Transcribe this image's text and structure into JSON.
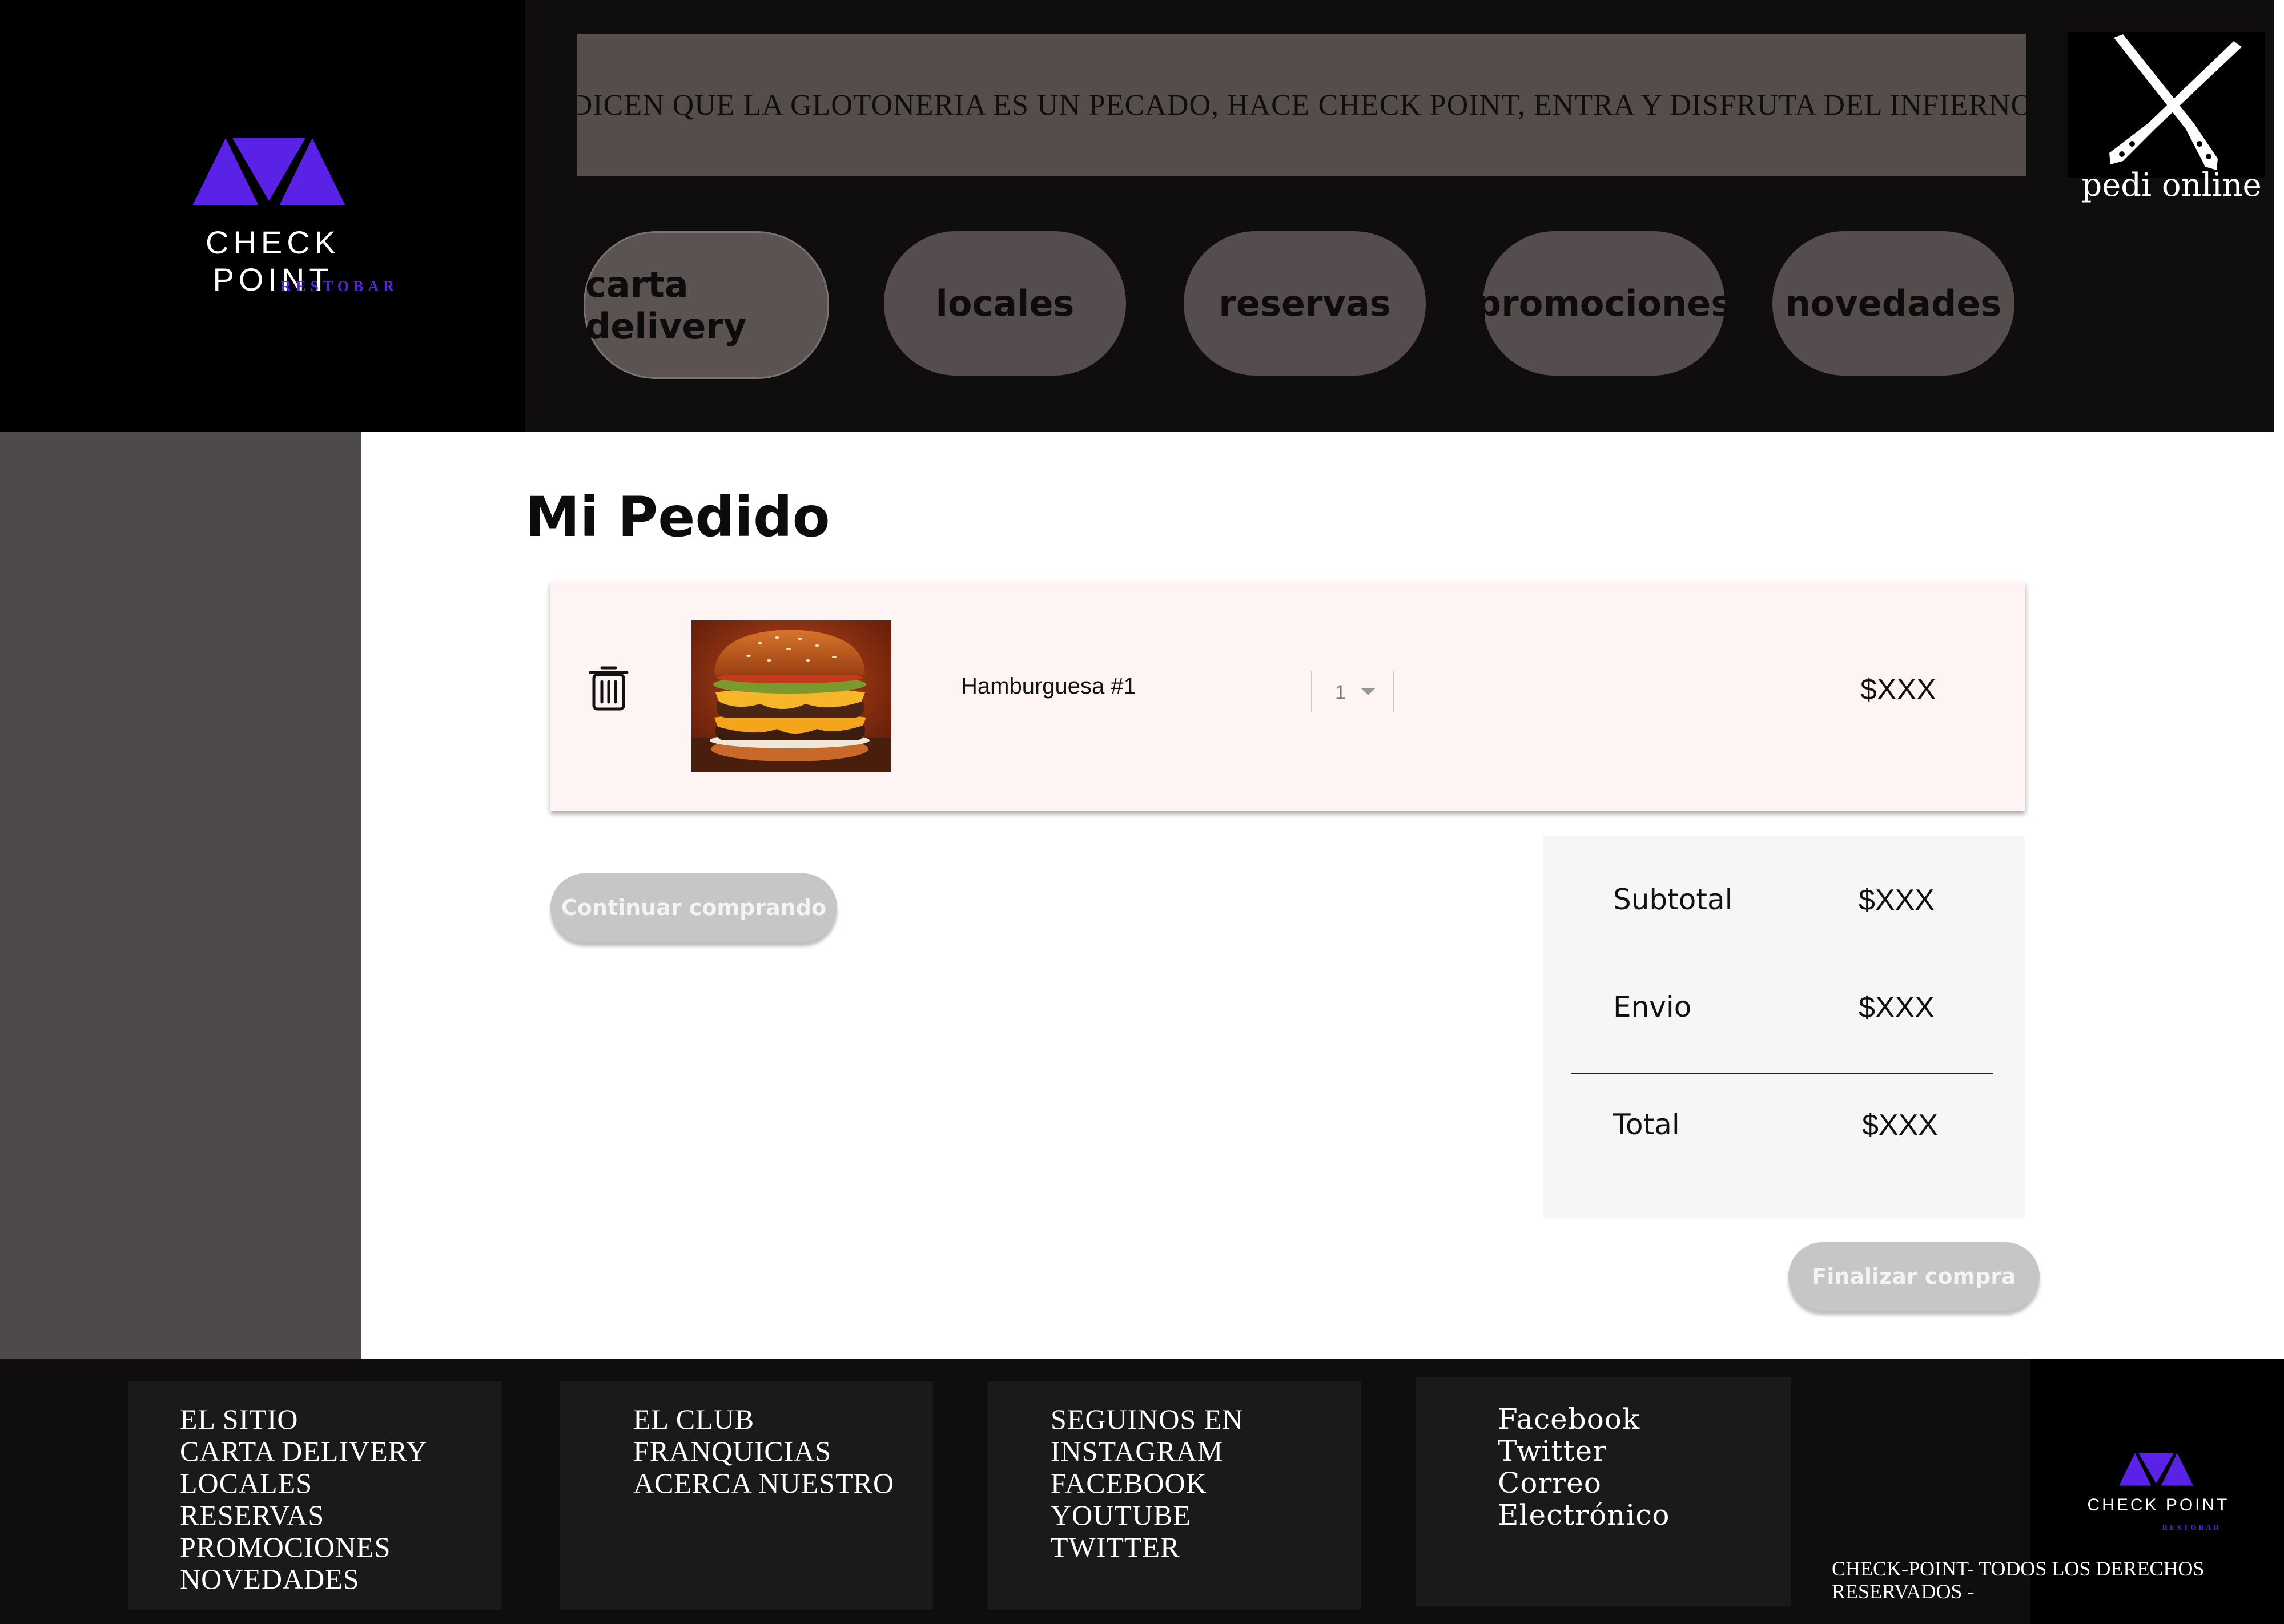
{
  "brand": {
    "name": "CHECK POINT",
    "subtitle": "RESTOBAR",
    "accent_color": "#5a22e6"
  },
  "header": {
    "slogan": "DICEN QUE LA GLOTONERIA ES UN PECADO, HACE CHECK POINT, ENTRA Y DISFRUTA DEL INFIERNO",
    "online_label": "pedi online",
    "online_icon": "crossed-knives-icon",
    "nav": [
      {
        "label": "carta delivery"
      },
      {
        "label": "locales"
      },
      {
        "label": "reservas"
      },
      {
        "label": "promociones"
      },
      {
        "label": "novedades"
      }
    ]
  },
  "main": {
    "title": "Mi Pedido",
    "cart_items": [
      {
        "name": "Hamburguesa #1",
        "quantity": "1",
        "price": "$XXX",
        "delete_icon": "trash-icon",
        "image": "burger-photo"
      }
    ],
    "continue_label": "Continuar comprando",
    "finish_label": "Finalizar compra",
    "summary": {
      "subtotal_label": "Subtotal",
      "subtotal_value": "$XXX",
      "shipping_label": "Envio",
      "shipping_value": "$XXX",
      "total_label": "Total",
      "total_value": "$XXX"
    }
  },
  "footer": {
    "columns": [
      [
        "EL SITIO",
        "CARTA DELIVERY",
        "LOCALES",
        "RESERVAS",
        "PROMOCIONES",
        "NOVEDADES"
      ],
      [
        "EL CLUB",
        "FRANQUICIAS",
        "ACERCA NUESTRO"
      ],
      [
        "SEGUINOS EN",
        "INSTAGRAM",
        "FACEBOOK",
        "YOUTUBE",
        "TWITTER"
      ],
      [
        "Facebook",
        "Twitter",
        "Correo",
        "Electrónico"
      ]
    ],
    "copyright": "CHECK-POINT- TODOS LOS DERECHOS RESERVADOS -"
  }
}
